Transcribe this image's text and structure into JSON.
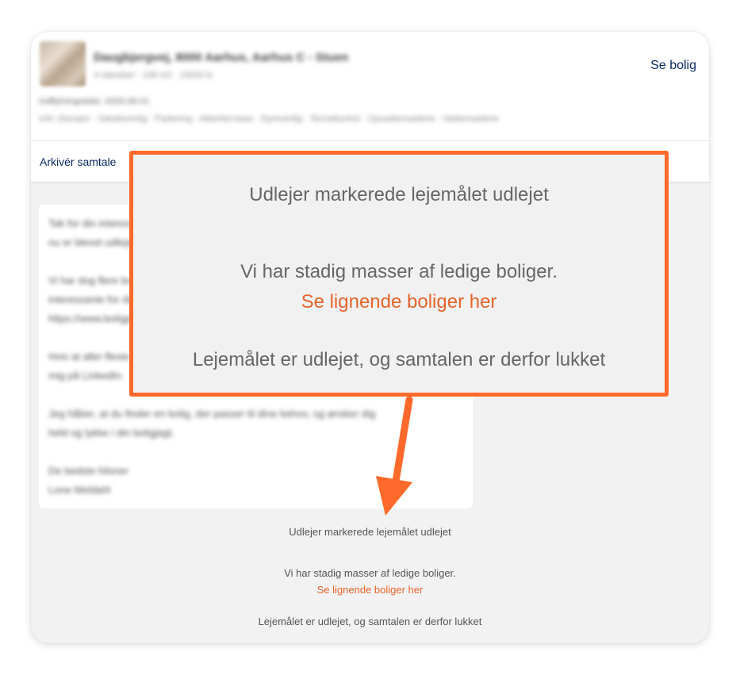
{
  "listing": {
    "address": "Daugbjergvej, 8000 Aarhus, Aarhus C - Stuen",
    "meta": "4 værelser · 108 m2 · 15000 kr",
    "move_in": "Indflytningsdato: 2025-08-01",
    "facilities": "Info: Elevator · Gæstevenlig · Parkering · Altan/terrasse · Dyrevenlig · Termokontrol · Opvaskemaskine · Vaskemaskine",
    "see_home_label": "Se bolig"
  },
  "actions": {
    "archive_label": "Arkivér samtale"
  },
  "message": {
    "paragraphs": [
      "Tak for din interesse i boligen. Boligen\nnu er blevet udlejet.",
      "Vi har dog flere boliger, der kunne være\ninteressante for dig. Du kan se dem her:\nhttps://www.boligportal.dk",
      "Hvis at aller fleste bolig, du kan kontakte\nmig på LinkedIn.",
      "Jeg håber, at du finder en bolig, der passer til dine behov, og ønsker dig\nheld og lykke i din boligjagt.",
      "De bedste hilsner\nLone Meldahl"
    ]
  },
  "system": {
    "rented_notice": "Udlejer markerede lejemålet udlejet",
    "more_homes": "Vi har stadig masser af ledige boliger.",
    "similar_link": "Se lignende boliger her",
    "closed_notice": "Lejemålet er udlejet, og samtalen er derfor lukket"
  },
  "colors": {
    "accent_orange": "#ff6a2b",
    "link_orange": "#e8632b",
    "navy": "#0a2a66"
  }
}
